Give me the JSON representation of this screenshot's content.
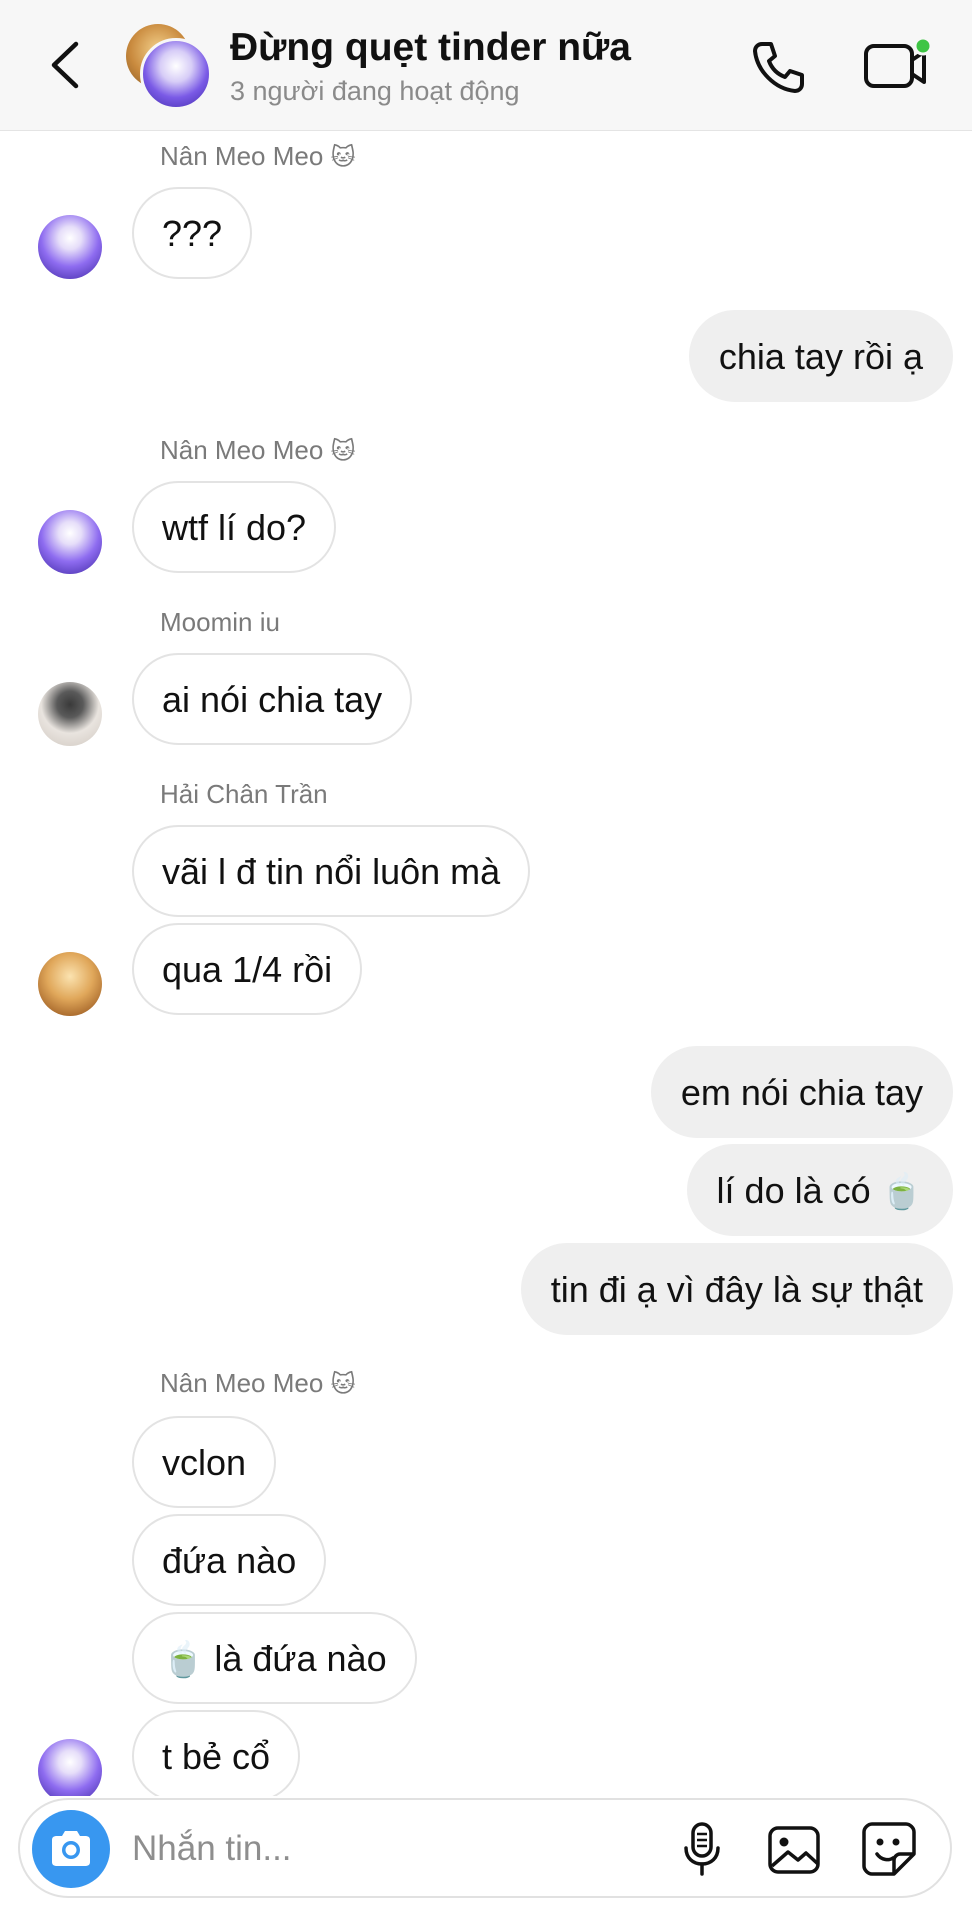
{
  "header": {
    "title": "Đừng quẹt tinder nữa",
    "subtitle": "3 người đang hoạt động"
  },
  "messages": [
    {
      "type": "sender",
      "text": "Nân Meo Meo",
      "emoji": "🐱"
    },
    {
      "type": "in",
      "text": "???"
    },
    {
      "type": "out",
      "text": "chia tay rồi ạ"
    },
    {
      "type": "sender",
      "text": "Nân Meo Meo",
      "emoji": "🐱"
    },
    {
      "type": "in",
      "text": "wtf lí do?"
    },
    {
      "type": "sender",
      "text": "Moomin iu"
    },
    {
      "type": "in",
      "text": "ai nói chia tay"
    },
    {
      "type": "sender",
      "text": "Hải Chân Trần"
    },
    {
      "type": "in",
      "text": "vãi l đ tin nổi luôn mà"
    },
    {
      "type": "in",
      "text": "qua 1/4 rồi"
    },
    {
      "type": "out",
      "text": "em nói chia tay"
    },
    {
      "type": "out",
      "text": "lí do là có",
      "emoji_after": "🍵"
    },
    {
      "type": "out",
      "text": "tin đi ạ vì đây là sự thật"
    },
    {
      "type": "sender",
      "text": "Nân Meo Meo",
      "emoji": "🐱"
    },
    {
      "type": "in",
      "text": "vclon"
    },
    {
      "type": "in",
      "text": "đứa nào"
    },
    {
      "type": "in",
      "text": "là đứa nào",
      "emoji_before": "🍵"
    },
    {
      "type": "in",
      "text": "t bẻ cổ"
    }
  ],
  "composer": {
    "placeholder": "Nhắn tin..."
  },
  "icons": {
    "back": "chevron-left-icon",
    "call": "phone-icon",
    "video": "video-camera-icon",
    "camera": "camera-icon",
    "mic": "microphone-icon",
    "gallery": "image-icon",
    "sticker": "sticker-icon"
  },
  "colors": {
    "accent": "#3897f0",
    "active_dot": "#3ec545",
    "outgoing_bubble": "#efefef",
    "incoming_border": "#e3e3e3"
  }
}
